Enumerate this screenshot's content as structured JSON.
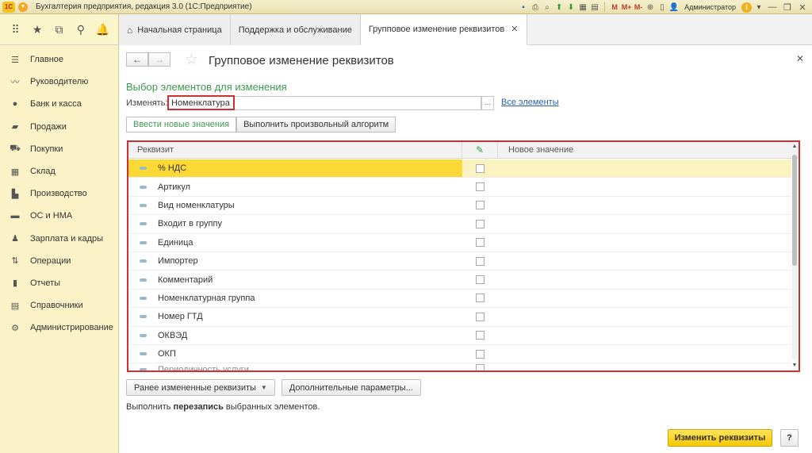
{
  "app": {
    "logo_text": "1С",
    "title": "Бухгалтерия предприятия, редакция 3.0  (1С:Предприятие)",
    "user": "Администратор",
    "toolbar_letters": [
      "M",
      "M+",
      "M-"
    ]
  },
  "tabs": [
    {
      "label": "Начальная страница"
    },
    {
      "label": "Поддержка и обслуживание"
    },
    {
      "label": "Групповое изменение реквизитов"
    }
  ],
  "sidebar": {
    "items": [
      {
        "label": "Главное",
        "icon": "menu-icon"
      },
      {
        "label": "Руководителю",
        "icon": "trend-icon"
      },
      {
        "label": "Банк и касса",
        "icon": "coin-icon"
      },
      {
        "label": "Продажи",
        "icon": "bag-icon"
      },
      {
        "label": "Покупки",
        "icon": "cart-icon"
      },
      {
        "label": "Склад",
        "icon": "warehouse-icon"
      },
      {
        "label": "Производство",
        "icon": "factory-icon"
      },
      {
        "label": "ОС и НМА",
        "icon": "truck-icon"
      },
      {
        "label": "Зарплата и кадры",
        "icon": "person-icon"
      },
      {
        "label": "Операции",
        "icon": "operations-icon"
      },
      {
        "label": "Отчеты",
        "icon": "report-icon"
      },
      {
        "label": "Справочники",
        "icon": "book-icon"
      },
      {
        "label": "Администрирование",
        "icon": "gear-icon"
      }
    ]
  },
  "form": {
    "title": "Групповое изменение реквизитов",
    "group_title": "Выбор элементов для изменения",
    "change_label": "Изменять:",
    "change_value": "Номенклатура",
    "select_button": "...",
    "all_elements_link": "Все элементы",
    "tab_new_values": "Ввести новые значения",
    "tab_algorithm": "Выполнить произвольный алгоритм",
    "table": {
      "col_attribute": "Реквизит",
      "col_new_value": "Новое значение",
      "rows": [
        {
          "label": "% НДС"
        },
        {
          "label": "Артикул"
        },
        {
          "label": "Вид номенклатуры"
        },
        {
          "label": "Входит в группу"
        },
        {
          "label": "Единица"
        },
        {
          "label": "Импортер"
        },
        {
          "label": "Комментарий"
        },
        {
          "label": "Номенклатурная группа"
        },
        {
          "label": "Номер ГТД"
        },
        {
          "label": "ОКВЭД"
        },
        {
          "label": "ОКП"
        },
        {
          "label": "Периодичность услуги"
        }
      ]
    },
    "btn_prev_changed": "Ранее измененные реквизиты",
    "btn_extra_params": "Дополнительные параметры...",
    "note_prefix": "Выполнить ",
    "note_bold": "перезапись",
    "note_suffix": " выбранных элементов.",
    "btn_apply": "Изменить реквизиты",
    "btn_help": "?"
  },
  "colors": {
    "accent_yellow": "#fad835",
    "highlight_red": "#d23030",
    "group_green": "#3c9a4c",
    "sidebar_bg": "#fbf3c7"
  }
}
